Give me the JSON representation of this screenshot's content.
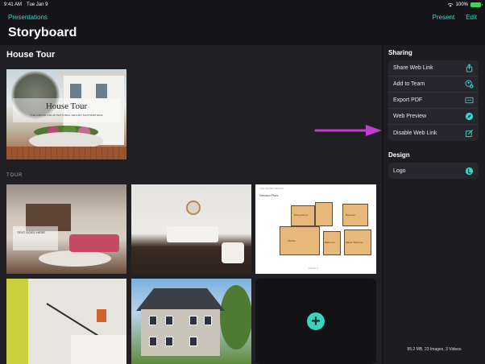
{
  "status_bar": {
    "time": "9:41 AM",
    "date": "Tue Jan 9",
    "battery": "100%"
  },
  "nav": {
    "back_label": "Presentations",
    "present_label": "Present",
    "edit_label": "Edit"
  },
  "page_title": "Storyboard",
  "section_title": "House Tour",
  "cover": {
    "title": "House Tour",
    "subtitle": "THE GRAND ARCHITECTURAL DESIGN MASTERPIECE"
  },
  "tour_label": "TOUR",
  "tiles": {
    "living_overlay": "TEXT GOES HERE",
    "floorplan_header": "THE HOUSE DESIGN",
    "floorplan_title": "Second Floor",
    "floorplan_rooms": [
      "Dining Room",
      "Bedroom",
      "Kitchen",
      "Bathroom",
      "Master Bedroom"
    ],
    "floorplan_footer": "LEVEL 2"
  },
  "sidebar": {
    "sharing_heading": "Sharing",
    "sharing_items": [
      {
        "label": "Share Web Link",
        "icon": "share-icon"
      },
      {
        "label": "Add to Team",
        "icon": "team-icon"
      },
      {
        "label": "Export PDF",
        "icon": "pdf-icon"
      },
      {
        "label": "Web Preview",
        "icon": "compass-icon"
      },
      {
        "label": "Disable Web Link",
        "icon": "edit-icon"
      }
    ],
    "design_heading": "Design",
    "design_items": [
      {
        "label": "Logo",
        "icon": "logo-icon"
      }
    ],
    "storage_info": "85.2 MB, 23 Images, 3 Videos"
  },
  "colors": {
    "accent": "#3ad6c6",
    "arrow": "#c13dd0"
  }
}
